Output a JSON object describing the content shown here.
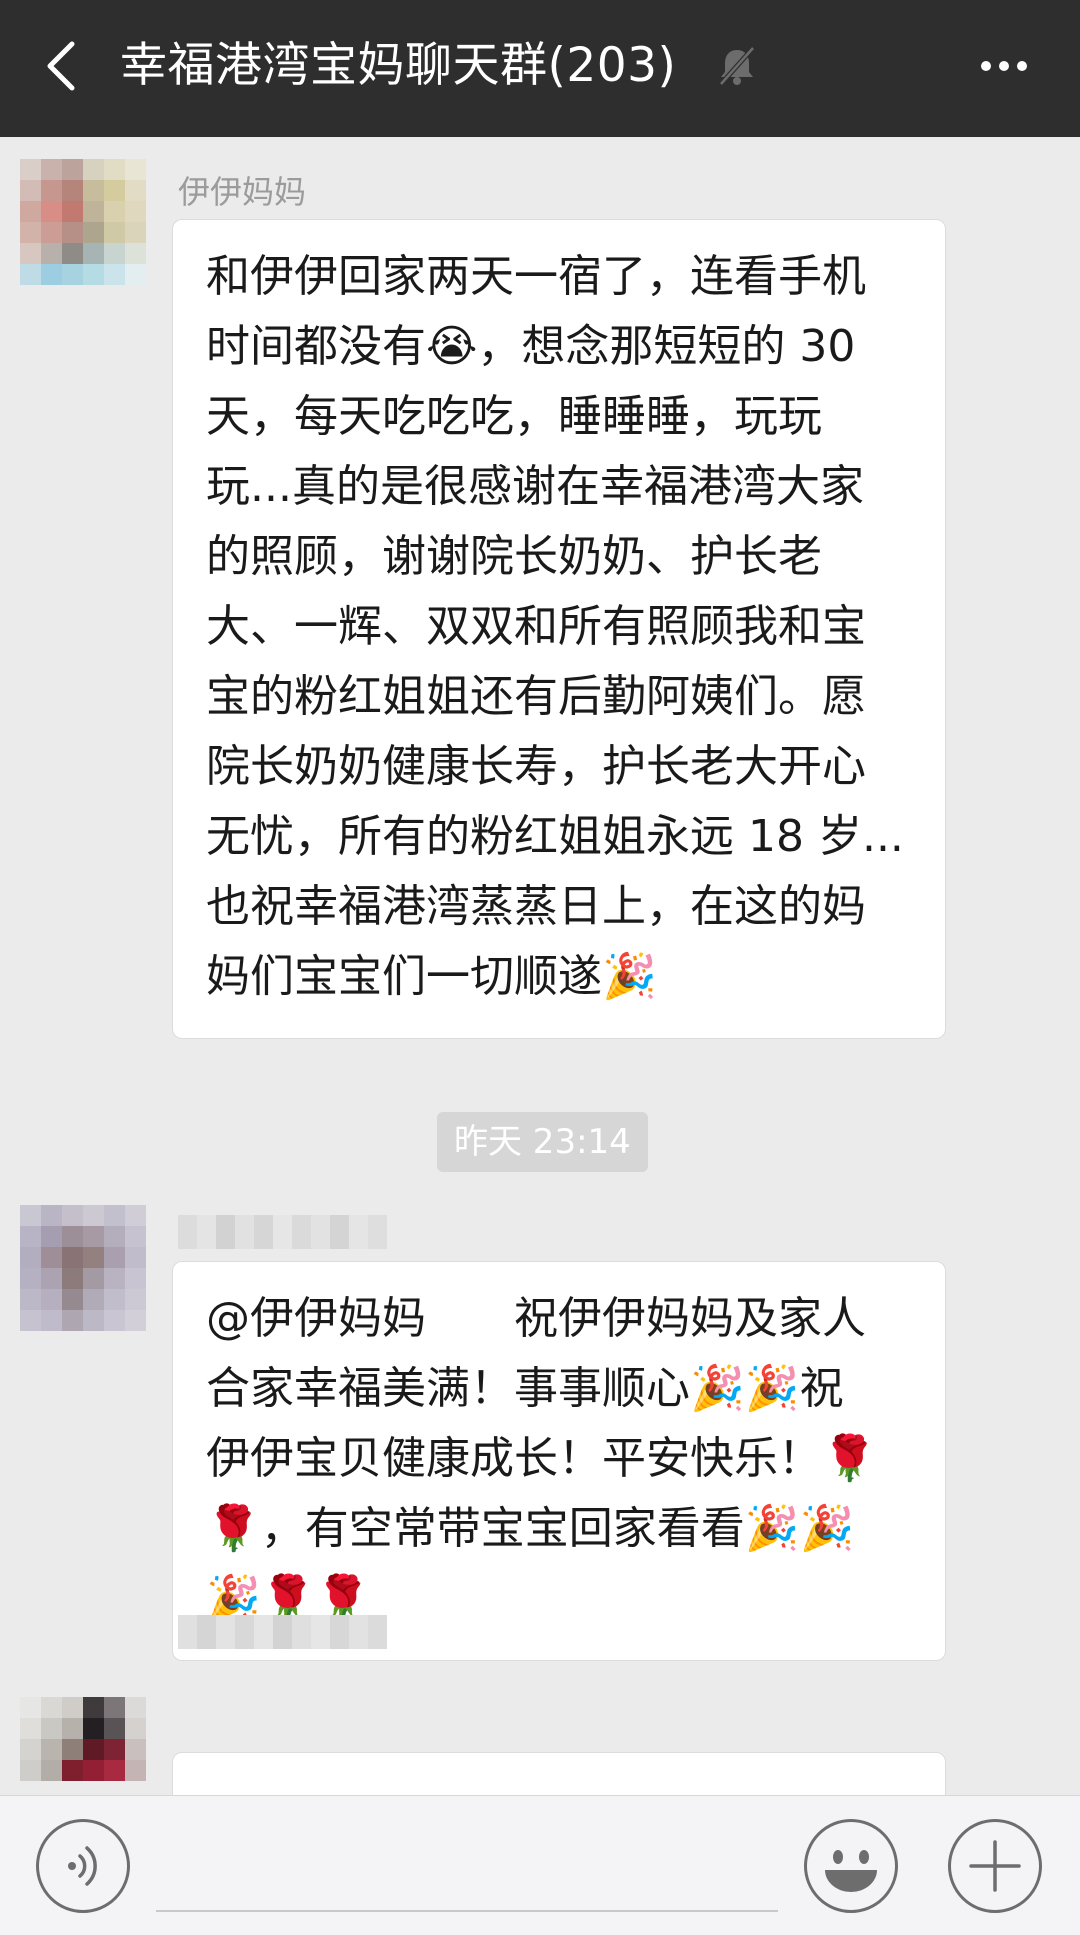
{
  "header": {
    "title": "幸福港湾宝妈聊天群(203)",
    "back_icon": "chevron-left-icon",
    "mute_icon": "bell-muted-icon",
    "more_icon": "more-dots-icon",
    "background_color": "#2e2e2e"
  },
  "messages": [
    {
      "sender": "伊伊妈妈",
      "avatar": "blurred-avatar",
      "lines": [
        "和伊伊回家两天一宿了，连看手机",
        "时间都没有😭，想念那短短的 30",
        "天，每天吃吃吃，睡睡睡，玩玩",
        "玩...真的是很感谢在幸福港湾大家",
        "的照顾，谢谢院长奶奶、护长老",
        "大、一辉、双双和所有照顾我和宝",
        "宝的粉红姐姐还有后勤阿姨们。愿",
        "院长奶奶健康长寿，护长老大开心",
        "无忧，所有的粉红姐姐永远 18 岁...",
        "也祝幸福港湾蒸蒸日上，在这的妈",
        "妈们宝宝们一切顺遂🎉"
      ]
    },
    {
      "sender": "",
      "avatar": "blurred-avatar",
      "lines": [
        "@伊伊妈妈　　祝伊伊妈妈及家人",
        "合家幸福美满！事事顺心🎉🎉祝",
        "伊伊宝贝健康成长！平安快乐！🌹",
        "🌹，有空常带宝宝回家看看🎉🎉",
        "🎉🌹🌹"
      ]
    },
    {
      "sender": "",
      "avatar": "blurred-avatar",
      "lines": [
        ""
      ]
    }
  ],
  "timestamp": "昨天 23:14",
  "input_bar": {
    "voice_icon": "voice-icon",
    "emoji_icon": "emoji-face-icon",
    "plus_icon": "plus-icon",
    "placeholder": ""
  }
}
